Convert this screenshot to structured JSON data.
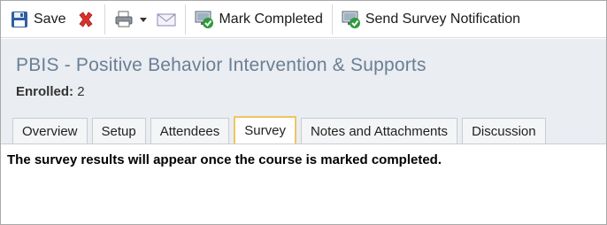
{
  "toolbar": {
    "save_label": "Save",
    "delete_icon": "red-x-icon",
    "print_icon": "printer-icon",
    "email_icon": "envelope-icon",
    "mark_completed_label": "Mark Completed",
    "send_survey_label": "Send Survey Notification"
  },
  "header": {
    "title": "PBIS - Positive Behavior Intervention & Supports",
    "enrolled_label": "Enrolled:",
    "enrolled_value": "2"
  },
  "tabs": [
    {
      "label": "Overview",
      "active": false
    },
    {
      "label": "Setup",
      "active": false
    },
    {
      "label": "Attendees",
      "active": false
    },
    {
      "label": "Survey",
      "active": true
    },
    {
      "label": "Notes and Attachments",
      "active": false
    },
    {
      "label": "Discussion",
      "active": false
    }
  ],
  "content": {
    "message": "The survey results will appear once the course is marked completed."
  },
  "colors": {
    "title": "#6a7f96",
    "header_bg": "#eaedf1",
    "active_tab_border": "#f0c463",
    "delete_red": "#d9322b"
  }
}
